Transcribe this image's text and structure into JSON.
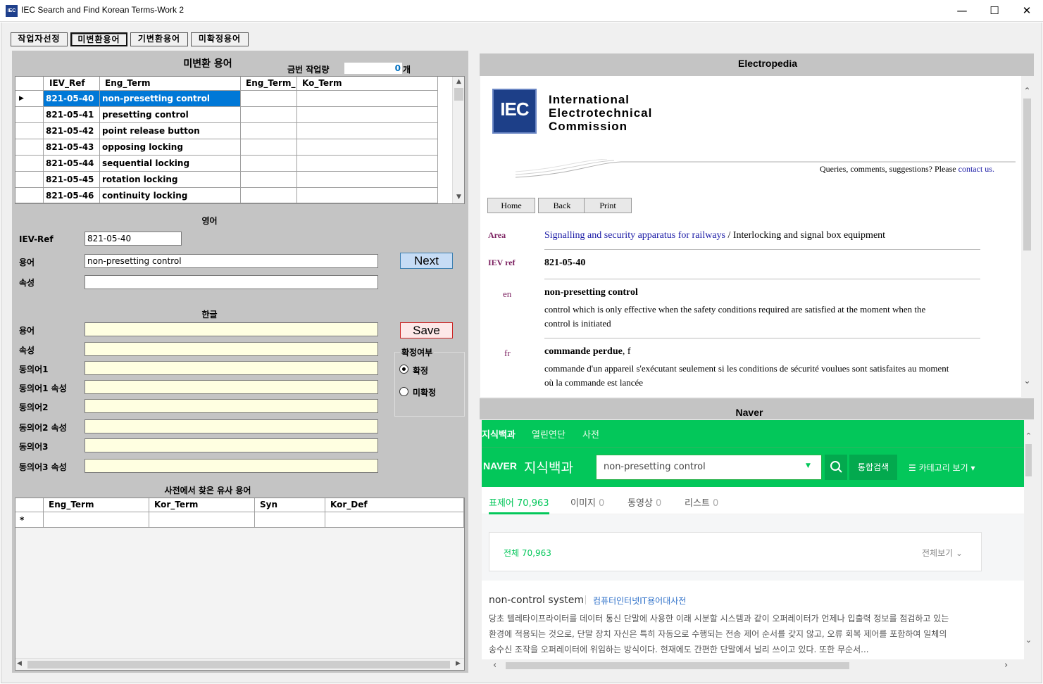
{
  "window": {
    "title": "IEC Search and Find Korean Terms-Work 2",
    "icon_text": "IEC",
    "minimize": "—",
    "maximize": "☐",
    "close": "✕"
  },
  "tabs": [
    {
      "label": "작업자선정"
    },
    {
      "label": "미변환용어"
    },
    {
      "label": "기변환용어"
    },
    {
      "label": "미확정용어"
    }
  ],
  "left": {
    "title": "미변환 용어",
    "workload_label": "금번 작업량",
    "workload_value": "0",
    "workload_unit": "개",
    "grid": {
      "columns": [
        "IEV_Ref",
        "Eng_Term",
        "Eng_Term_",
        "Ko_Term"
      ],
      "rows": [
        {
          "ref": "821-05-40",
          "term": "non-presetting control"
        },
        {
          "ref": "821-05-41",
          "term": "presetting control"
        },
        {
          "ref": "821-05-42",
          "term": "point release button"
        },
        {
          "ref": "821-05-43",
          "term": "opposing locking"
        },
        {
          "ref": "821-05-44",
          "term": "sequential locking"
        },
        {
          "ref": "821-05-45",
          "term": "rotation locking"
        },
        {
          "ref": "821-05-46",
          "term": "continuity locking"
        }
      ]
    },
    "english": {
      "title": "영어",
      "ievref_label": "IEV-Ref",
      "ievref_value": "821-05-40",
      "term_label": "용어",
      "term_value": "non-presetting control",
      "attr_label": "속성",
      "attr_value": "",
      "next_label": "Next"
    },
    "korean": {
      "title": "한글",
      "fields": [
        "용어",
        "속성",
        "동의어1",
        "동의어1 속성",
        "동의어2",
        "동의어2 속성",
        "동의어3",
        "동의어3 속성"
      ],
      "save_label": "Save",
      "confirm_group": "확정여부",
      "confirm_yes": "확정",
      "confirm_no": "미확정"
    },
    "similar": {
      "title": "사전에서 찾은 유사 용어",
      "columns": [
        "Eng_Term",
        "Kor_Term",
        "Syn",
        "Kor_Def"
      ],
      "new_row_marker": "*"
    }
  },
  "electropedia": {
    "title": "Electropedia",
    "logo_text": "IEC",
    "org_line1": "International",
    "org_line2": "Electrotechnical",
    "org_line3": "Commission",
    "queries": "Queries, comments, suggestions? Please ",
    "contact": "contact us.",
    "buttons": [
      "Home",
      "Back",
      "Print"
    ],
    "area_label": "Area",
    "area_link": "Signalling and security apparatus for railways",
    "area_sep": " / ",
    "area_rest": "Interlocking and signal box equipment",
    "ievref_label": "IEV ref",
    "ievref_value": "821-05-40",
    "en_lang": "en",
    "en_term": "non-presetting control",
    "en_def": "control which is only effective when the safety conditions required are satisfied at the moment when the control is initiated",
    "fr_lang": "fr",
    "fr_term": "commande perdue",
    "fr_gender": ", f",
    "fr_def": "commande d'un appareil s'exécutant seulement si les conditions de sécurité voulues sont satisfaites au moment où la commande est lancée"
  },
  "naver": {
    "title": "Naver",
    "top_tabs": [
      "지식백과",
      "열린연단",
      "사전"
    ],
    "brand": "NAVER",
    "service": "지식백과",
    "search_value": "non-presetting control",
    "search_button": "통합검색",
    "category_button": "카테고리 보기",
    "result_tabs": [
      {
        "label": "표제어",
        "count": "70,963"
      },
      {
        "label": "이미지",
        "count": "0"
      },
      {
        "label": "동영상",
        "count": "0"
      },
      {
        "label": "리스트",
        "count": "0"
      }
    ],
    "total_label": "전체",
    "total_count": "70,963",
    "view_all": "전체보기",
    "result_title": "non-control system",
    "result_source": "컴퓨터인터넷IT용어대사전",
    "result_snippet": "당초 텔레타이프라이터를 데이터 통신 단말에 사용한 이래 시분할 시스템과 같이 오퍼레이터가 언제나 입출력 정보를 점검하고 있는 환경에 적용되는 것으로, 단말 장치 자신은 특히 자동으로 수행되는 전송 제어 순서를 갖지 않고, 오류 회복 제어를 포함하여 일체의 송수신 조작을 오퍼레이터에 위임하는 방식이다. 현재에도 간편한 단말에서 널리 쓰이고 있다. 또한 무순서..."
  },
  "colors": {
    "selection": "#0078d7",
    "naver_green": "#03c75a",
    "korean_field": "#ffffe1",
    "link_blue": "#1a1aa6",
    "label_purple": "#7b1f5f"
  }
}
